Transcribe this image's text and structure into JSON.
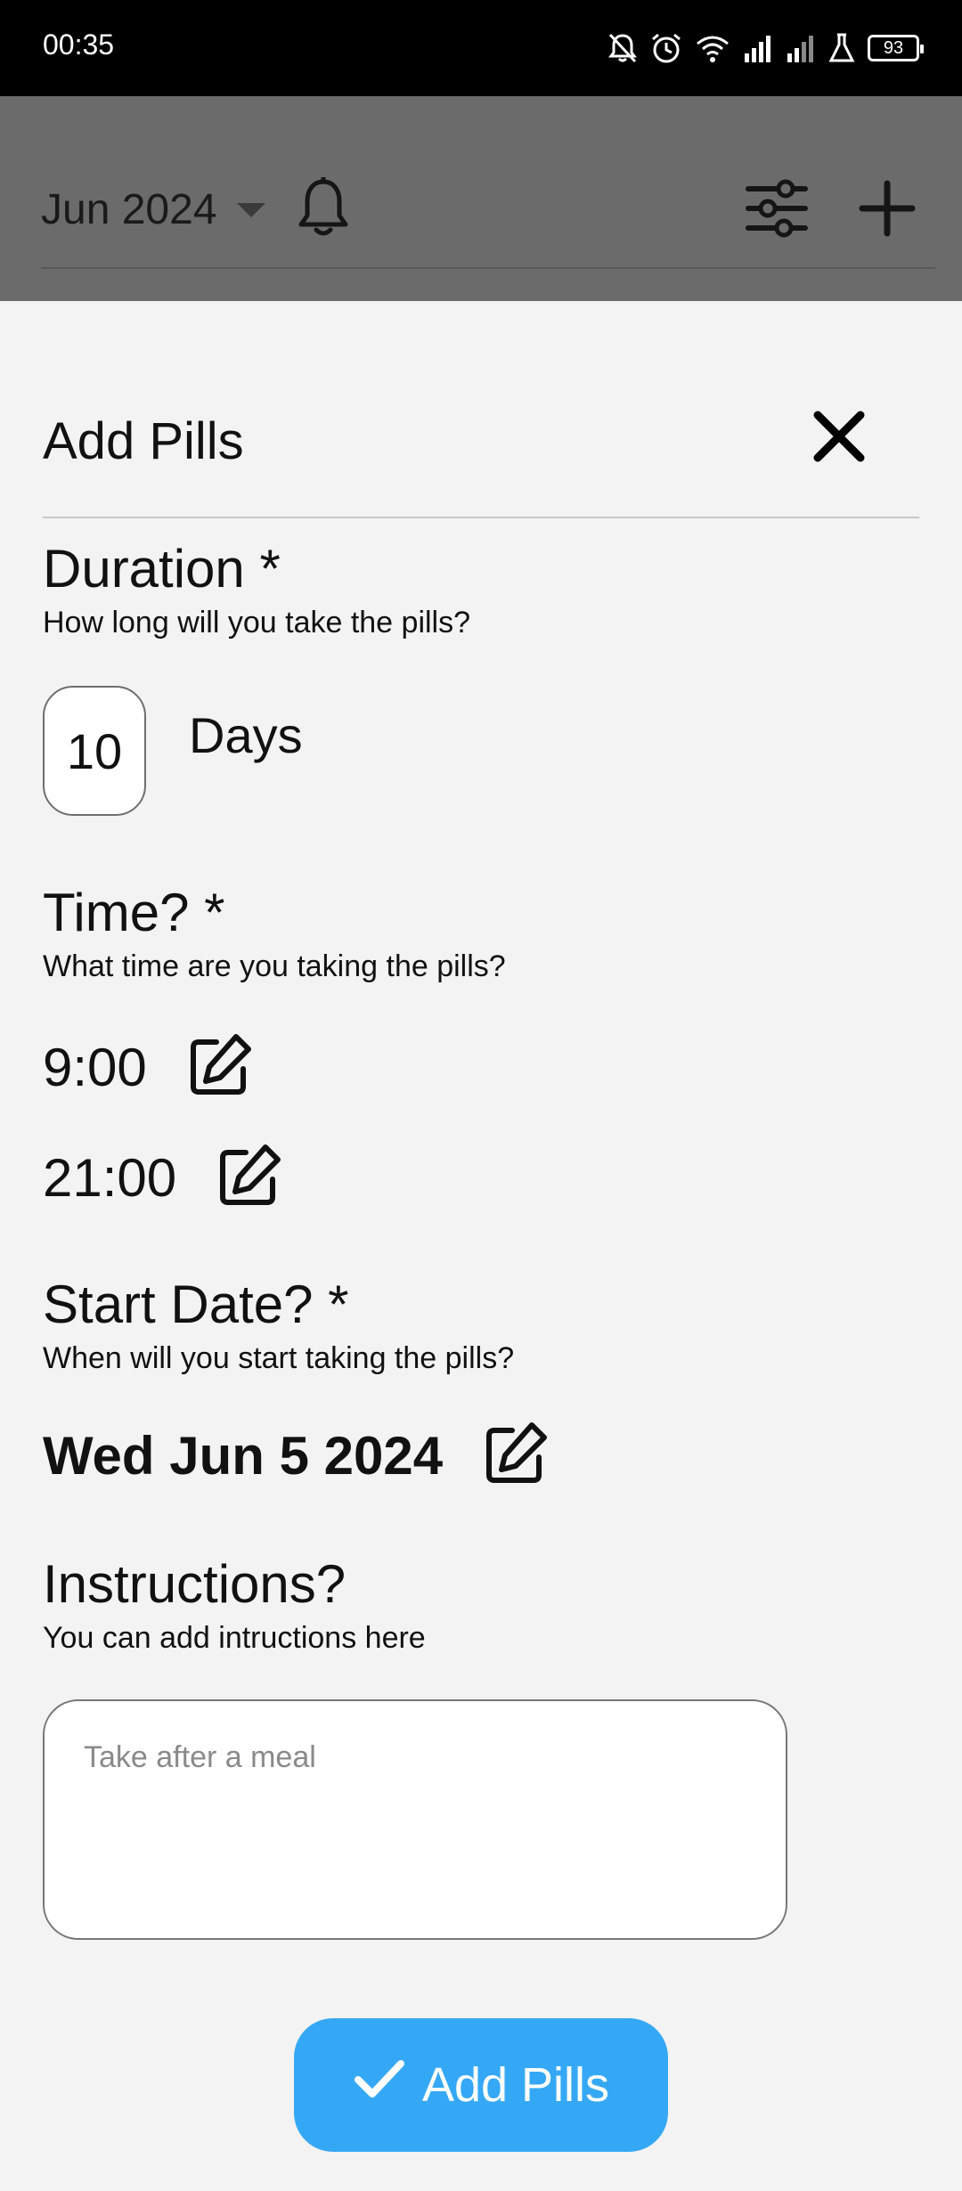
{
  "status_bar": {
    "time": "00:35",
    "battery": "93",
    "icons": [
      "bell-off-icon",
      "alarm-icon",
      "wifi-icon",
      "signal-icon",
      "signal-icon",
      "flask-icon",
      "battery-icon"
    ]
  },
  "app_bar": {
    "month": "Jun 2024",
    "icons": [
      "caret-down-icon",
      "bell-icon",
      "filter-icon",
      "plus-icon"
    ]
  },
  "sheet": {
    "title": "Add Pills",
    "duration": {
      "heading": "Duration *",
      "subtitle": "How long will you take the pills?",
      "value": "10",
      "unit": "Days"
    },
    "time": {
      "heading": "Time? *",
      "subtitle": "What time are you taking the pills?",
      "entries": [
        "9:00",
        "21:00"
      ]
    },
    "start_date": {
      "heading": "Start Date? *",
      "subtitle": "When will you start taking the pills?",
      "value": "Wed Jun 5 2024"
    },
    "instructions": {
      "heading": "Instructions?",
      "subtitle": "You can add intructions here",
      "placeholder": "Take after a meal",
      "value": ""
    },
    "submit_label": "Add Pills"
  },
  "colors": {
    "accent": "#35a8f5",
    "overlay": "#6b6b6b",
    "sheet_bg": "#f3f3f3"
  }
}
